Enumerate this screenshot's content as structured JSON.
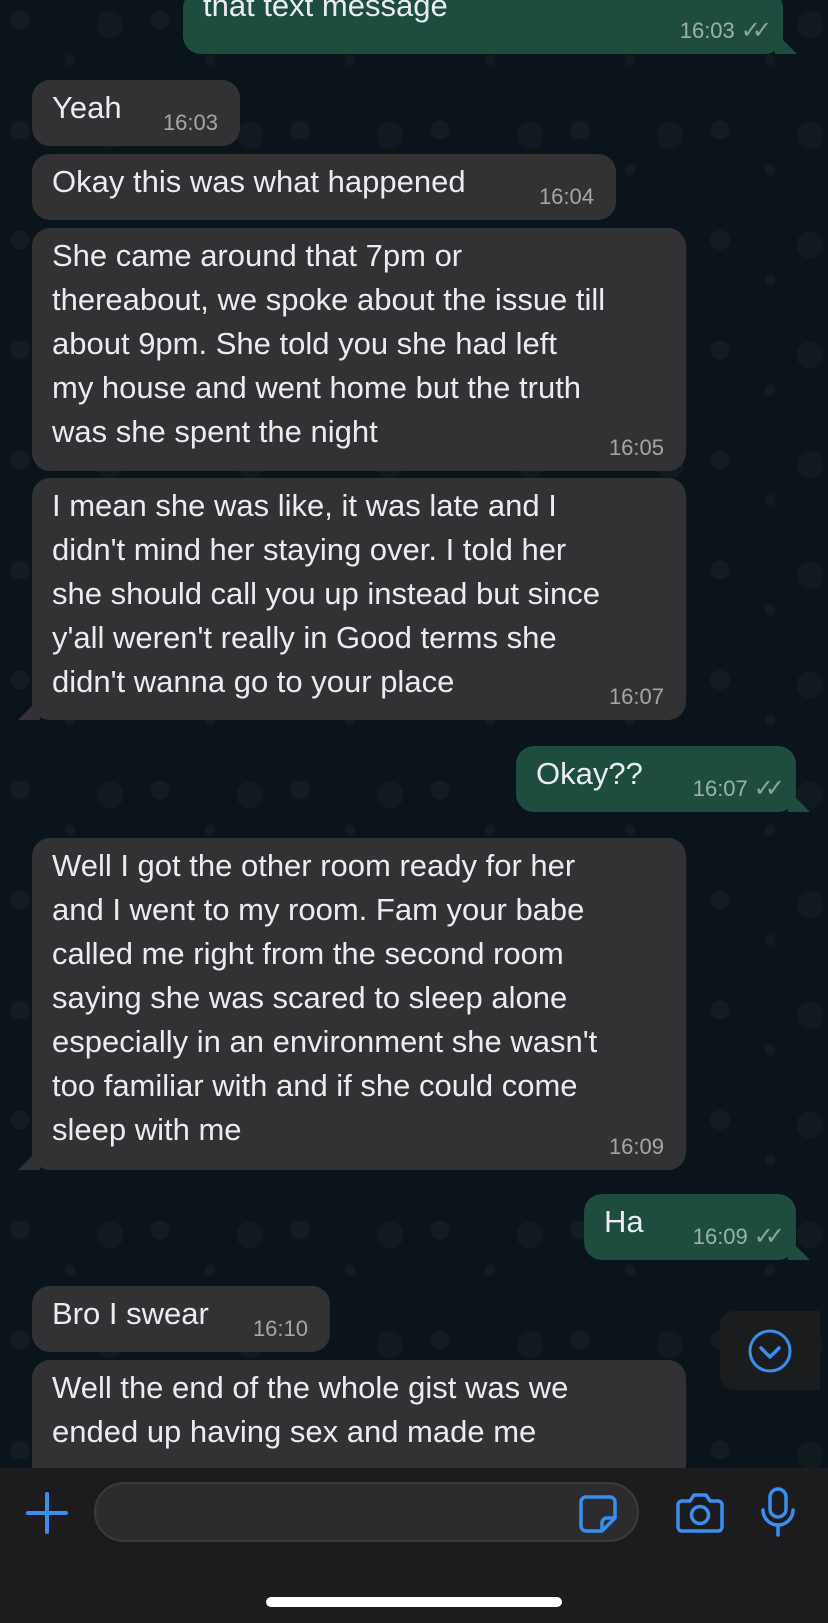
{
  "colors": {
    "accent": "#3b8ef0",
    "incoming_bubble": "#323234",
    "outgoing_bubble": "#1e4d3f",
    "chat_background": "#0b141a"
  },
  "messages": [
    {
      "direction": "out",
      "text": "that text message",
      "time": "16:03",
      "status": "read"
    },
    {
      "direction": "in",
      "text": "Yeah",
      "time": "16:03"
    },
    {
      "direction": "in",
      "text": "Okay this was what happened",
      "time": "16:04"
    },
    {
      "direction": "in",
      "text": "She came around that 7pm or\nthereabout, we spoke about the issue till\nabout 9pm. She told you she had left\nmy house and went home but the truth\nwas she spent the night",
      "time": "16:05"
    },
    {
      "direction": "in",
      "text": "I mean she was like, it was late and I\ndidn't mind her staying over. I told her\nshe should call you up instead but since\ny'all weren't really in Good terms she\ndidn't wanna go to your place",
      "time": "16:07"
    },
    {
      "direction": "out",
      "text": "Okay??",
      "time": "16:07",
      "status": "read"
    },
    {
      "direction": "in",
      "text": "Well I got the other room ready for her\nand I went to my room. Fam your babe\ncalled me right from the second room\nsaying she was scared to sleep alone\nespecially in an environment she wasn't\ntoo familiar with and if she could come\nsleep with me",
      "time": "16:09"
    },
    {
      "direction": "out",
      "text": "Ha",
      "time": "16:09",
      "status": "read"
    },
    {
      "direction": "in",
      "text": "Bro I swear",
      "time": "16:10"
    },
    {
      "direction": "in",
      "text": "Well the end of the whole gist was we\nended up having sex and made me",
      "time": ""
    }
  ],
  "composer": {
    "input_value": "",
    "icons": [
      "plus-icon",
      "sticker-icon",
      "camera-icon",
      "microphone-icon"
    ]
  },
  "scroll_down_icon": "chevron-down-circle-icon"
}
